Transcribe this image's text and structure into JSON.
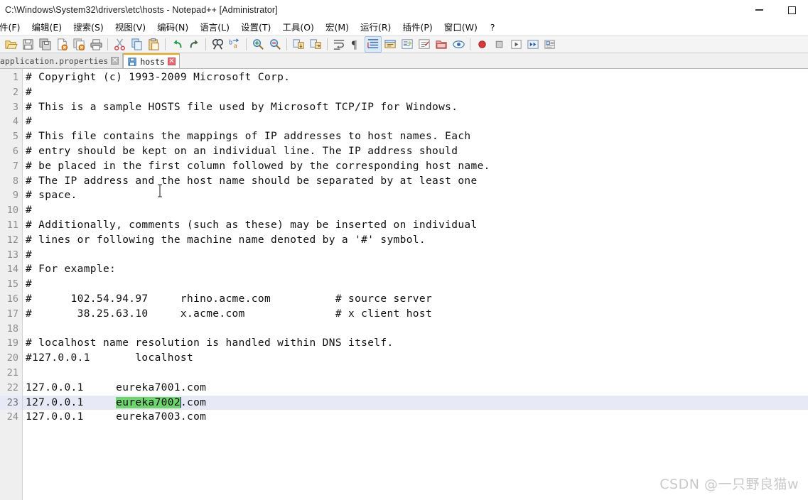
{
  "window": {
    "title": "C:\\Windows\\System32\\drivers\\etc\\hosts - Notepad++ [Administrator]",
    "minimize_label": "—",
    "maximize_label": "□",
    "controls": [
      {
        "name": "minimize-button",
        "icon": "minimize-icon"
      },
      {
        "name": "maximize-button",
        "icon": "maximize-icon"
      }
    ]
  },
  "menubar": {
    "items": [
      {
        "label": "件(F)",
        "name": "menu-file",
        "clipped": true
      },
      {
        "label": "编辑(E)",
        "name": "menu-edit"
      },
      {
        "label": "搜索(S)",
        "name": "menu-search"
      },
      {
        "label": "视图(V)",
        "name": "menu-view"
      },
      {
        "label": "编码(N)",
        "name": "menu-encoding"
      },
      {
        "label": "语言(L)",
        "name": "menu-language"
      },
      {
        "label": "设置(T)",
        "name": "menu-settings"
      },
      {
        "label": "工具(O)",
        "name": "menu-tools"
      },
      {
        "label": "宏(M)",
        "name": "menu-macro"
      },
      {
        "label": "运行(R)",
        "name": "menu-run"
      },
      {
        "label": "插件(P)",
        "name": "menu-plugins"
      },
      {
        "label": "窗口(W)",
        "name": "menu-window"
      },
      {
        "label": "?",
        "name": "menu-help"
      }
    ]
  },
  "toolbar": {
    "buttons": [
      {
        "name": "open-file-icon",
        "title": "打开"
      },
      {
        "name": "save-icon",
        "title": "保存"
      },
      {
        "name": "save-all-icon",
        "title": "保存所有"
      },
      {
        "name": "close-file-icon",
        "title": "关闭"
      },
      {
        "name": "close-all-icon",
        "title": "关闭所有"
      },
      {
        "name": "print-icon",
        "title": "打印"
      },
      {
        "sep": true
      },
      {
        "name": "cut-icon",
        "title": "剪切"
      },
      {
        "name": "copy-icon",
        "title": "复制"
      },
      {
        "name": "paste-icon",
        "title": "粘贴"
      },
      {
        "sep": true
      },
      {
        "name": "undo-icon",
        "title": "撤销"
      },
      {
        "name": "redo-icon",
        "title": "重做"
      },
      {
        "sep": true
      },
      {
        "name": "find-icon",
        "title": "查找"
      },
      {
        "name": "replace-icon",
        "title": "替换"
      },
      {
        "sep": true
      },
      {
        "name": "zoom-in-icon",
        "title": "放大"
      },
      {
        "name": "zoom-out-icon",
        "title": "缩小"
      },
      {
        "sep": true
      },
      {
        "name": "sync-vertical-scroll-icon",
        "title": "同步垂直滚动"
      },
      {
        "name": "sync-horizontal-scroll-icon",
        "title": "同步水平滚动"
      },
      {
        "sep": true
      },
      {
        "name": "word-wrap-icon",
        "title": "自动换行"
      },
      {
        "name": "show-all-characters-icon",
        "title": "显示所有字符"
      },
      {
        "name": "indent-guide-icon",
        "title": "显示缩进参考线",
        "active": true
      },
      {
        "name": "user-defined-dialog-icon",
        "title": "用户自定义语言"
      },
      {
        "name": "document-map-icon",
        "title": "文档缩略图"
      },
      {
        "name": "function-list-icon",
        "title": "函数列表"
      },
      {
        "name": "folder-as-workspace-icon",
        "title": "文件夹作为工作区"
      },
      {
        "name": "monitoring-icon",
        "title": "监视文件"
      },
      {
        "sep": true
      },
      {
        "name": "macro-record-icon",
        "title": "开始录制宏"
      },
      {
        "name": "macro-stop-icon",
        "title": "停止录制宏"
      },
      {
        "name": "macro-play-icon",
        "title": "播放宏"
      },
      {
        "name": "macro-run-multiple-icon",
        "title": "多次运行宏"
      },
      {
        "name": "macro-save-icon",
        "title": "保存当前录制的宏"
      }
    ]
  },
  "tabs": [
    {
      "label": "application.properties",
      "active": false,
      "name": "tab-application-properties",
      "close_label": "✕"
    },
    {
      "label": "hosts",
      "active": true,
      "name": "tab-hosts",
      "close_label": "✕"
    }
  ],
  "editor": {
    "current_line": 23,
    "selection": {
      "line": 23,
      "text": "eureka7002",
      "color": "#6ed46e"
    },
    "current_line_color": "#e8e9f7",
    "lines": [
      {
        "n": 1,
        "text": "# Copyright (c) 1993-2009 Microsoft Corp."
      },
      {
        "n": 2,
        "text": "#"
      },
      {
        "n": 3,
        "text": "# This is a sample HOSTS file used by Microsoft TCP/IP for Windows."
      },
      {
        "n": 4,
        "text": "#"
      },
      {
        "n": 5,
        "text": "# This file contains the mappings of IP addresses to host names. Each"
      },
      {
        "n": 6,
        "text": "# entry should be kept on an individual line. The IP address should"
      },
      {
        "n": 7,
        "text": "# be placed in the first column followed by the corresponding host name."
      },
      {
        "n": 8,
        "text": "# The IP address and the host name should be separated by at least one"
      },
      {
        "n": 9,
        "text": "# space."
      },
      {
        "n": 10,
        "text": "#"
      },
      {
        "n": 11,
        "text": "# Additionally, comments (such as these) may be inserted on individual"
      },
      {
        "n": 12,
        "text": "# lines or following the machine name denoted by a '#' symbol."
      },
      {
        "n": 13,
        "text": "#"
      },
      {
        "n": 14,
        "text": "# For example:"
      },
      {
        "n": 15,
        "text": "#"
      },
      {
        "n": 16,
        "text": "#      102.54.94.97     rhino.acme.com          # source server"
      },
      {
        "n": 17,
        "text": "#       38.25.63.10     x.acme.com              # x client host"
      },
      {
        "n": 18,
        "text": ""
      },
      {
        "n": 19,
        "text": "# localhost name resolution is handled within DNS itself."
      },
      {
        "n": 20,
        "text": "#127.0.0.1       localhost"
      },
      {
        "n": 21,
        "text": ""
      },
      {
        "n": 22,
        "text": "127.0.0.1     eureka7001.com"
      },
      {
        "n": 23,
        "text": "127.0.0.1     eureka7002.com",
        "parts": [
          {
            "t": "127.0.0.1     "
          },
          {
            "t": "eureka7002",
            "sel": true
          },
          {
            "caret": true
          },
          {
            "t": ".com"
          }
        ]
      },
      {
        "n": 24,
        "text": "127.0.0.1     eureka7003.com"
      }
    ]
  },
  "watermark": {
    "text": "CSDN @一只野良猫w"
  }
}
